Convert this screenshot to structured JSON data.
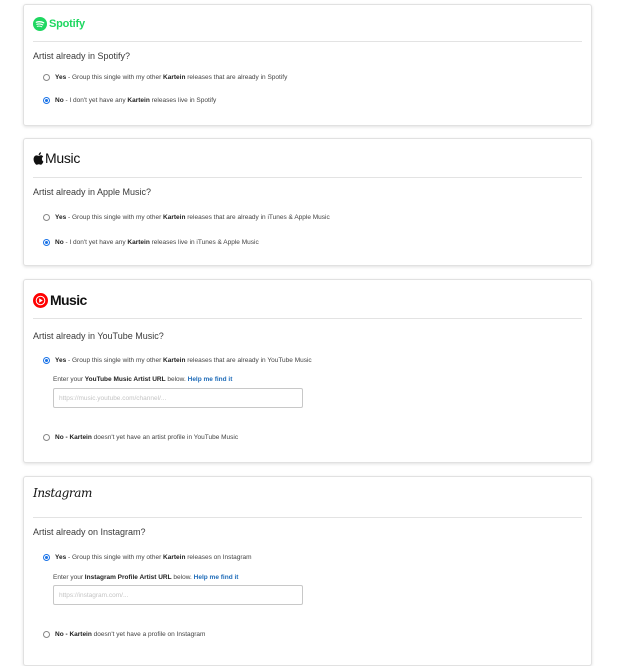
{
  "spotify": {
    "brand": "Spotify",
    "question": "Artist already in Spotify?",
    "yes": {
      "strong": "Yes",
      "pre": " - Group this single with my other ",
      "artist": "Kartein",
      "post": " releases that are already in Spotify"
    },
    "no": {
      "strong": "No",
      "pre": " - I don't yet have any ",
      "artist": "Kartein",
      "post": " releases live in Spotify"
    },
    "selected": "no"
  },
  "apple": {
    "brand": "Music",
    "question": "Artist already in Apple Music?",
    "yes": {
      "strong": "Yes",
      "pre": " - Group this single with my other ",
      "artist": "Kartein",
      "post": " releases that are already in iTunes & Apple Music"
    },
    "no": {
      "strong": "No",
      "pre": " - I don't yet have any ",
      "artist": "Kartein",
      "post": " releases live in iTunes & Apple Music"
    },
    "selected": "no"
  },
  "youtube": {
    "brand": "Music",
    "question": "Artist already in YouTube Music?",
    "yes": {
      "strong": "Yes",
      "pre": " - Group this single with my other ",
      "artist": "Kartein",
      "post": " releases that are already in YouTube Music"
    },
    "hint": {
      "pre": "Enter your ",
      "strong": "YouTube Music Artist URL",
      "post": " below. ",
      "link": "Help me find it"
    },
    "input": {
      "value": "",
      "placeholder": "https://music.youtube.com/channel/..."
    },
    "no": {
      "strong": "No - Kartein",
      "post": " doesn't yet have an artist profile in YouTube Music"
    },
    "selected": "yes"
  },
  "instagram": {
    "brand": "Instagram",
    "question": "Artist already on Instagram?",
    "yes": {
      "strong": "Yes",
      "pre": " - Group this single with my other ",
      "artist": "Kartein",
      "post": " releases on Instagram"
    },
    "hint": {
      "pre": "Enter your ",
      "strong": "Instagram Profile Artist URL",
      "post": " below. ",
      "link": "Help me find it"
    },
    "input": {
      "value": "",
      "placeholder": "https://instagram.com/..."
    },
    "no": {
      "strong": "No - Kartein",
      "post": " doesn't yet have a profile on Instagram"
    },
    "selected": "yes"
  },
  "colors": {
    "spotify_green": "#1ed760",
    "youtube_red": "#ff0000",
    "radio_blue": "#1a73e8",
    "link_blue": "#1e6bb8"
  }
}
